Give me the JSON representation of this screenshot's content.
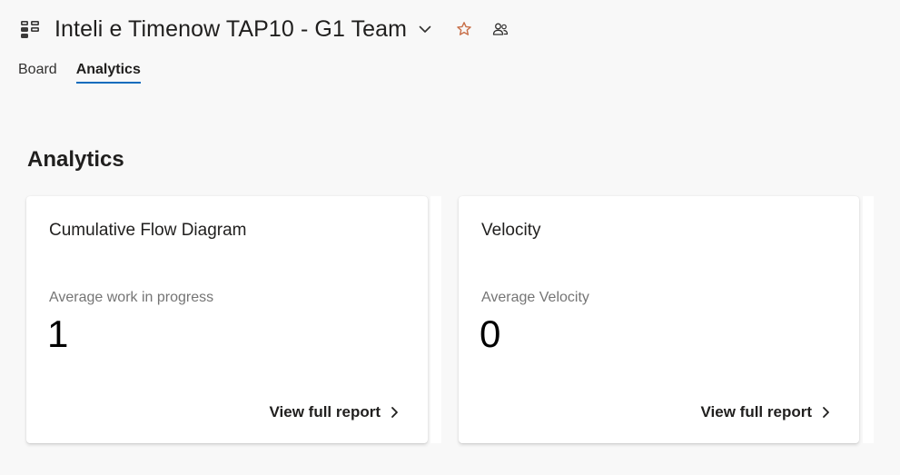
{
  "header": {
    "title": "Inteli e Timenow TAP10 - G1 Team",
    "board_icon": "board-icon",
    "favorite_icon": "star-icon",
    "team_icon": "team-members-icon"
  },
  "tabs": [
    {
      "label": "Board",
      "active": false
    },
    {
      "label": "Analytics",
      "active": true
    }
  ],
  "section": {
    "title": "Analytics"
  },
  "cards": [
    {
      "title": "Cumulative Flow Diagram",
      "metric_label": "Average work in progress",
      "metric_value": "1",
      "link_label": "View full report"
    },
    {
      "title": "Velocity",
      "metric_label": "Average Velocity",
      "metric_value": "0",
      "link_label": "View full report"
    }
  ],
  "colors": {
    "accent": "#0f6cbd",
    "star": "#c8704a",
    "background": "#f8f8f8"
  }
}
